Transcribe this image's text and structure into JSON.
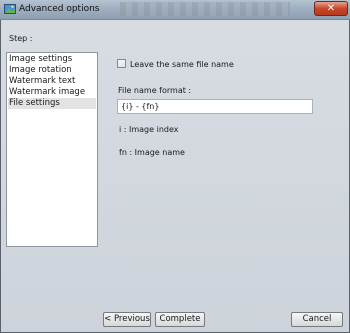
{
  "window": {
    "title": "Advanced options",
    "close_symbol": "✕",
    "app_icon": "image-icon"
  },
  "step": {
    "label": "Step :",
    "items": [
      {
        "label": "Image settings",
        "selected": false
      },
      {
        "label": "Image rotation",
        "selected": false
      },
      {
        "label": "Watermark text",
        "selected": false
      },
      {
        "label": "Watermark image",
        "selected": false
      },
      {
        "label": "File settings",
        "selected": true
      }
    ]
  },
  "file_settings": {
    "same_name_checkbox": {
      "label": "Leave the same file name",
      "checked": false
    },
    "format_label": "File name format :",
    "format_value": "{i} - {fn}",
    "hint_index": "i : Image index",
    "hint_name": "fn : Image name"
  },
  "buttons": {
    "previous": "< Previous",
    "complete": "Complete",
    "cancel": "Cancel"
  }
}
